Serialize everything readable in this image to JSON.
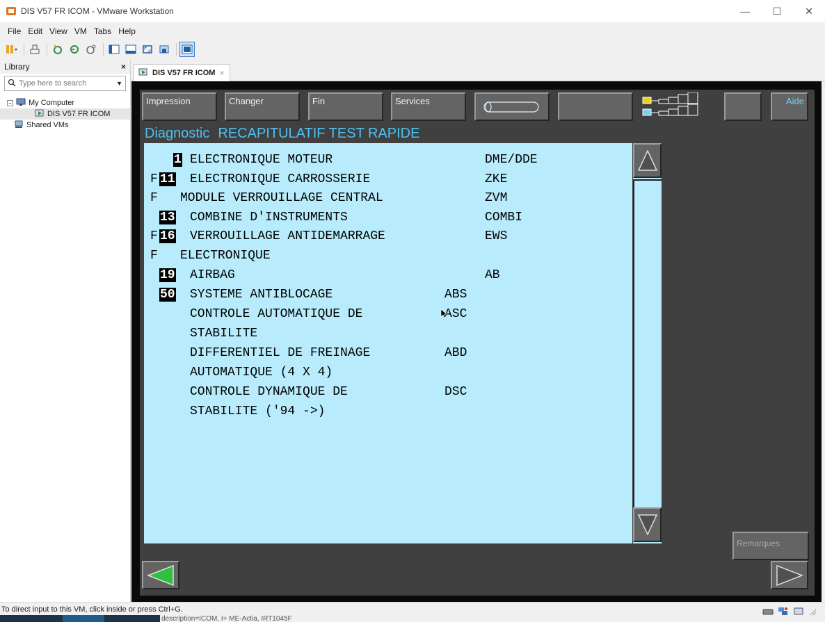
{
  "window": {
    "title": "DIS V57 FR ICOM - VMware Workstation",
    "controls": [
      "minimize",
      "maximize",
      "close"
    ]
  },
  "menu": [
    "File",
    "Edit",
    "View",
    "VM",
    "Tabs",
    "Help"
  ],
  "library": {
    "title": "Library",
    "close_label": "×",
    "search_placeholder": "Type here to search",
    "tree": {
      "root": "My Computer",
      "vm": "DIS V57 FR ICOM",
      "shared": "Shared VMs"
    }
  },
  "tab": {
    "label": "DIS V57 FR ICOM",
    "close": "×"
  },
  "dis": {
    "top_buttons": {
      "impression": "Impression",
      "changer": "Changer",
      "fin": "Fin",
      "services": "Services",
      "aide": "Aide"
    },
    "screen_title": {
      "prefix": "Diagnostic",
      "title": "RECAPITULATIF TEST RAPIDE"
    },
    "rows": [
      {
        "flag": " ",
        "num": "1",
        "label": "ELECTRONIQUE MOTEUR",
        "code": "DME/DDE"
      },
      {
        "flag": "F",
        "num": "11",
        "label": "ELECTRONIQUE CARROSSERIE",
        "code": "ZKE"
      },
      {
        "flag": "F",
        "num": "",
        "label": "MODULE VERROUILLAGE CENTRAL",
        "code": "ZVM"
      },
      {
        "flag": " ",
        "num": "13",
        "label": "COMBINE D'INSTRUMENTS",
        "code": "COMBI"
      },
      {
        "flag": "F",
        "num": "16",
        "label": "VERROUILLAGE ANTIDEMARRAGE",
        "code": "EWS"
      },
      {
        "flag": "F",
        "num": "",
        "label": "ELECTRONIQUE",
        "code": ""
      },
      {
        "flag": " ",
        "num": "19",
        "label": "AIRBAG",
        "code": "AB"
      },
      {
        "flag": " ",
        "num": "50",
        "label": "SYSTEME ANTIBLOCAGE",
        "code": "ABS"
      },
      {
        "flag": " ",
        "num": "",
        "label": "CONTROLE AUTOMATIQUE DE",
        "code": "ASC"
      },
      {
        "flag": " ",
        "num": "",
        "label": "STABILITE",
        "code": ""
      },
      {
        "flag": " ",
        "num": "",
        "label": "DIFFERENTIEL DE FREINAGE",
        "code": "ABD"
      },
      {
        "flag": " ",
        "num": "",
        "label": "AUTOMATIQUE (4 X 4)",
        "code": ""
      },
      {
        "flag": " ",
        "num": "",
        "label": "CONTROLE DYNAMIQUE DE",
        "code": "DSC"
      },
      {
        "flag": " ",
        "num": "",
        "label": "STABILITE ('94 ->)",
        "code": ""
      }
    ],
    "remarques": "Remarques"
  },
  "status": {
    "message": "To direct input to this VM, click inside or press Ctrl+G.",
    "under_text": "description=ICOM, I+ ME-Actia, IRT1045F"
  }
}
